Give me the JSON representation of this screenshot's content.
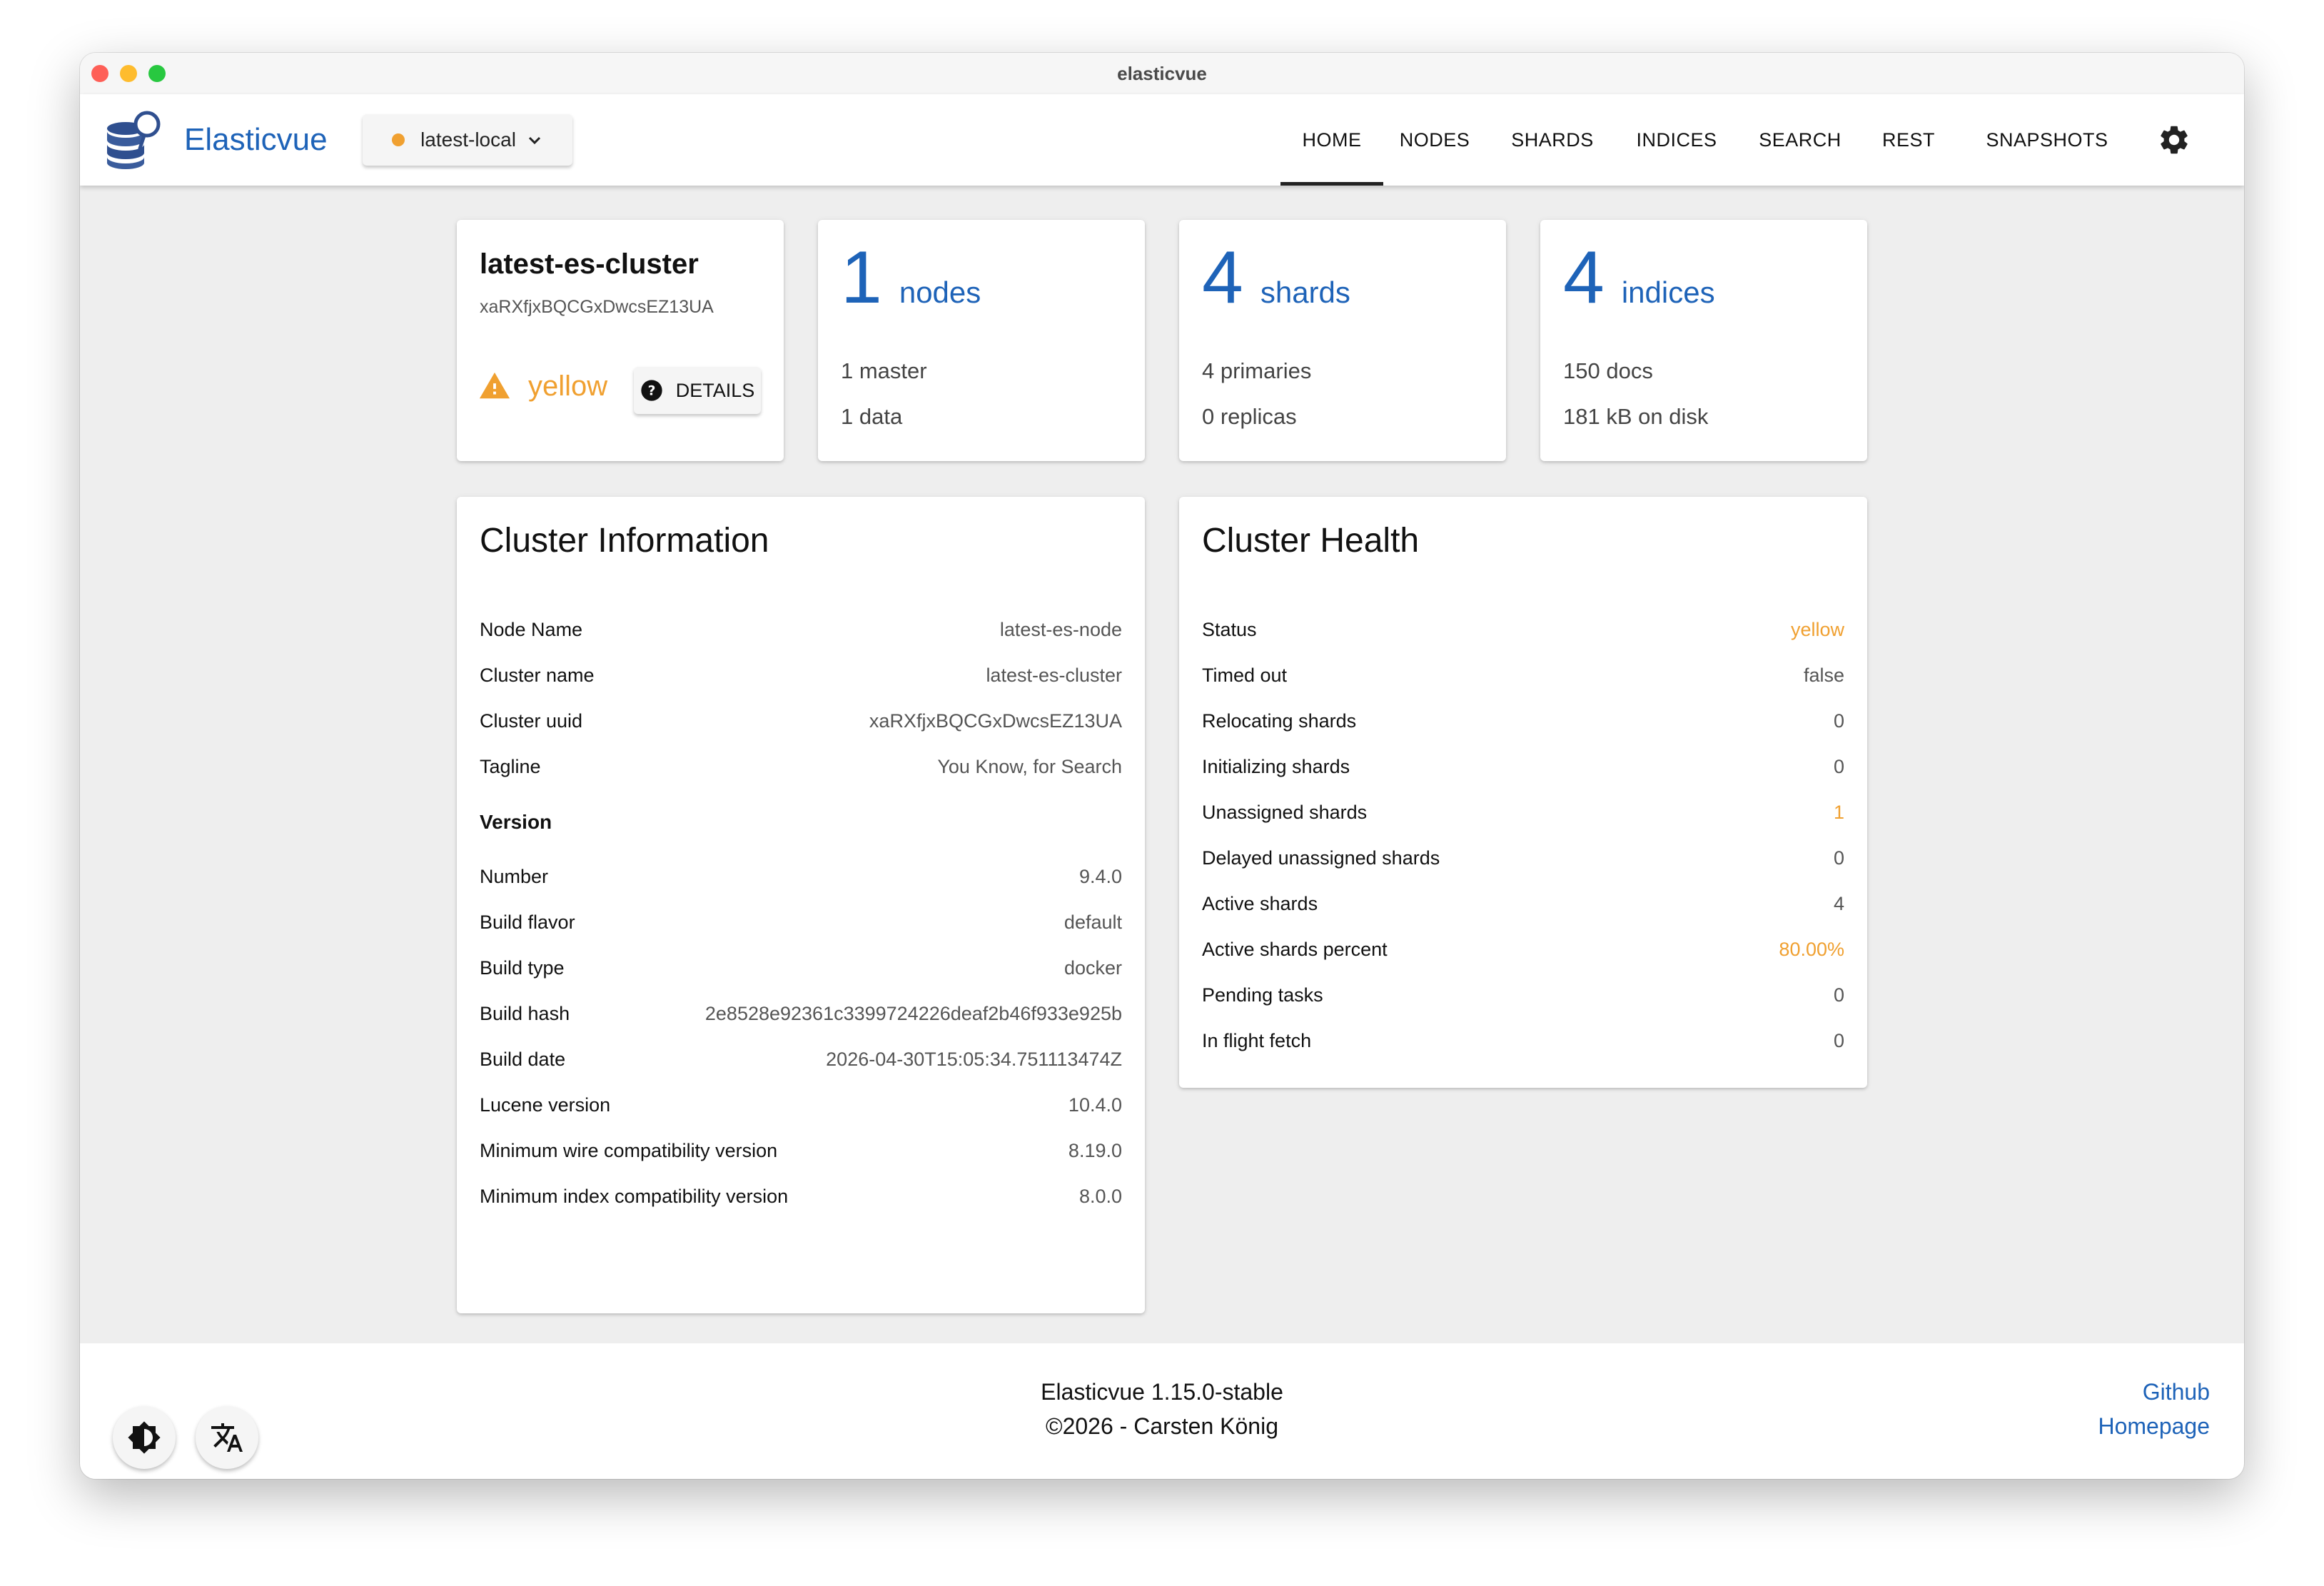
{
  "window": {
    "title": "elasticvue"
  },
  "header": {
    "brand": "Elasticvue",
    "cluster_selector": {
      "label": "latest-local",
      "status_color": "#f0a030"
    },
    "tabs": [
      {
        "label": "HOME",
        "active": true
      },
      {
        "label": "NODES"
      },
      {
        "label": "SHARDS"
      },
      {
        "label": "INDICES"
      },
      {
        "label": "SEARCH"
      },
      {
        "label": "REST"
      },
      {
        "label": "SNAPSHOTS"
      }
    ]
  },
  "summary": {
    "cluster": {
      "name": "latest-es-cluster",
      "uuid": "xaRXfjxBQCGxDwcsEZ13UA",
      "health": "yellow",
      "details_label": "DETAILS"
    },
    "nodes": {
      "count": "1",
      "unit": "nodes",
      "line1": "1 master",
      "line2": "1 data"
    },
    "shards": {
      "count": "4",
      "unit": "shards",
      "line1": "4 primaries",
      "line2": "0 replicas"
    },
    "indices": {
      "count": "4",
      "unit": "indices",
      "line1": "150 docs",
      "line2": "181 kB on disk"
    }
  },
  "cluster_information": {
    "title": "Cluster Information",
    "rows": [
      {
        "key": "Node Name",
        "value": "latest-es-node"
      },
      {
        "key": "Cluster name",
        "value": "latest-es-cluster"
      },
      {
        "key": "Cluster uuid",
        "value": "xaRXfjxBQCGxDwcsEZ13UA"
      },
      {
        "key": "Tagline",
        "value": "You Know, for Search"
      }
    ],
    "version_heading": "Version",
    "version_rows": [
      {
        "key": "Number",
        "value": "9.4.0"
      },
      {
        "key": "Build flavor",
        "value": "default"
      },
      {
        "key": "Build type",
        "value": "docker"
      },
      {
        "key": "Build hash",
        "value": "2e8528e92361c3399724226deaf2b46f933e925b"
      },
      {
        "key": "Build date",
        "value": "2026-04-30T15:05:34.751113474Z"
      },
      {
        "key": "Lucene version",
        "value": "10.4.0"
      },
      {
        "key": "Minimum wire compatibility version",
        "value": "8.19.0"
      },
      {
        "key": "Minimum index compatibility version",
        "value": "8.0.0"
      }
    ]
  },
  "cluster_health": {
    "title": "Cluster Health",
    "rows": [
      {
        "key": "Status",
        "value": "yellow",
        "highlight": true
      },
      {
        "key": "Timed out",
        "value": "false"
      },
      {
        "key": "Relocating shards",
        "value": "0"
      },
      {
        "key": "Initializing shards",
        "value": "0"
      },
      {
        "key": "Unassigned shards",
        "value": "1",
        "highlight": true
      },
      {
        "key": "Delayed unassigned shards",
        "value": "0"
      },
      {
        "key": "Active shards",
        "value": "4"
      },
      {
        "key": "Active shards percent",
        "value": "80.00%",
        "highlight": true
      },
      {
        "key": "Pending tasks",
        "value": "0"
      },
      {
        "key": "In flight fetch",
        "value": "0"
      }
    ]
  },
  "footer": {
    "version": "Elasticvue 1.15.0-stable",
    "copyright": "©2026 - Carsten König",
    "links": [
      "Github",
      "Homepage"
    ]
  },
  "icons": {
    "logo": "database-magnifier-icon",
    "chevron": "chevron-down-icon",
    "settings": "gear-icon",
    "warning": "warning-icon",
    "help": "question-circle-icon",
    "theme": "brightness-icon",
    "language": "translate-icon"
  },
  "colors": {
    "brand": "#1e63b8",
    "warning": "#f0a030",
    "background": "#eeeeee"
  }
}
